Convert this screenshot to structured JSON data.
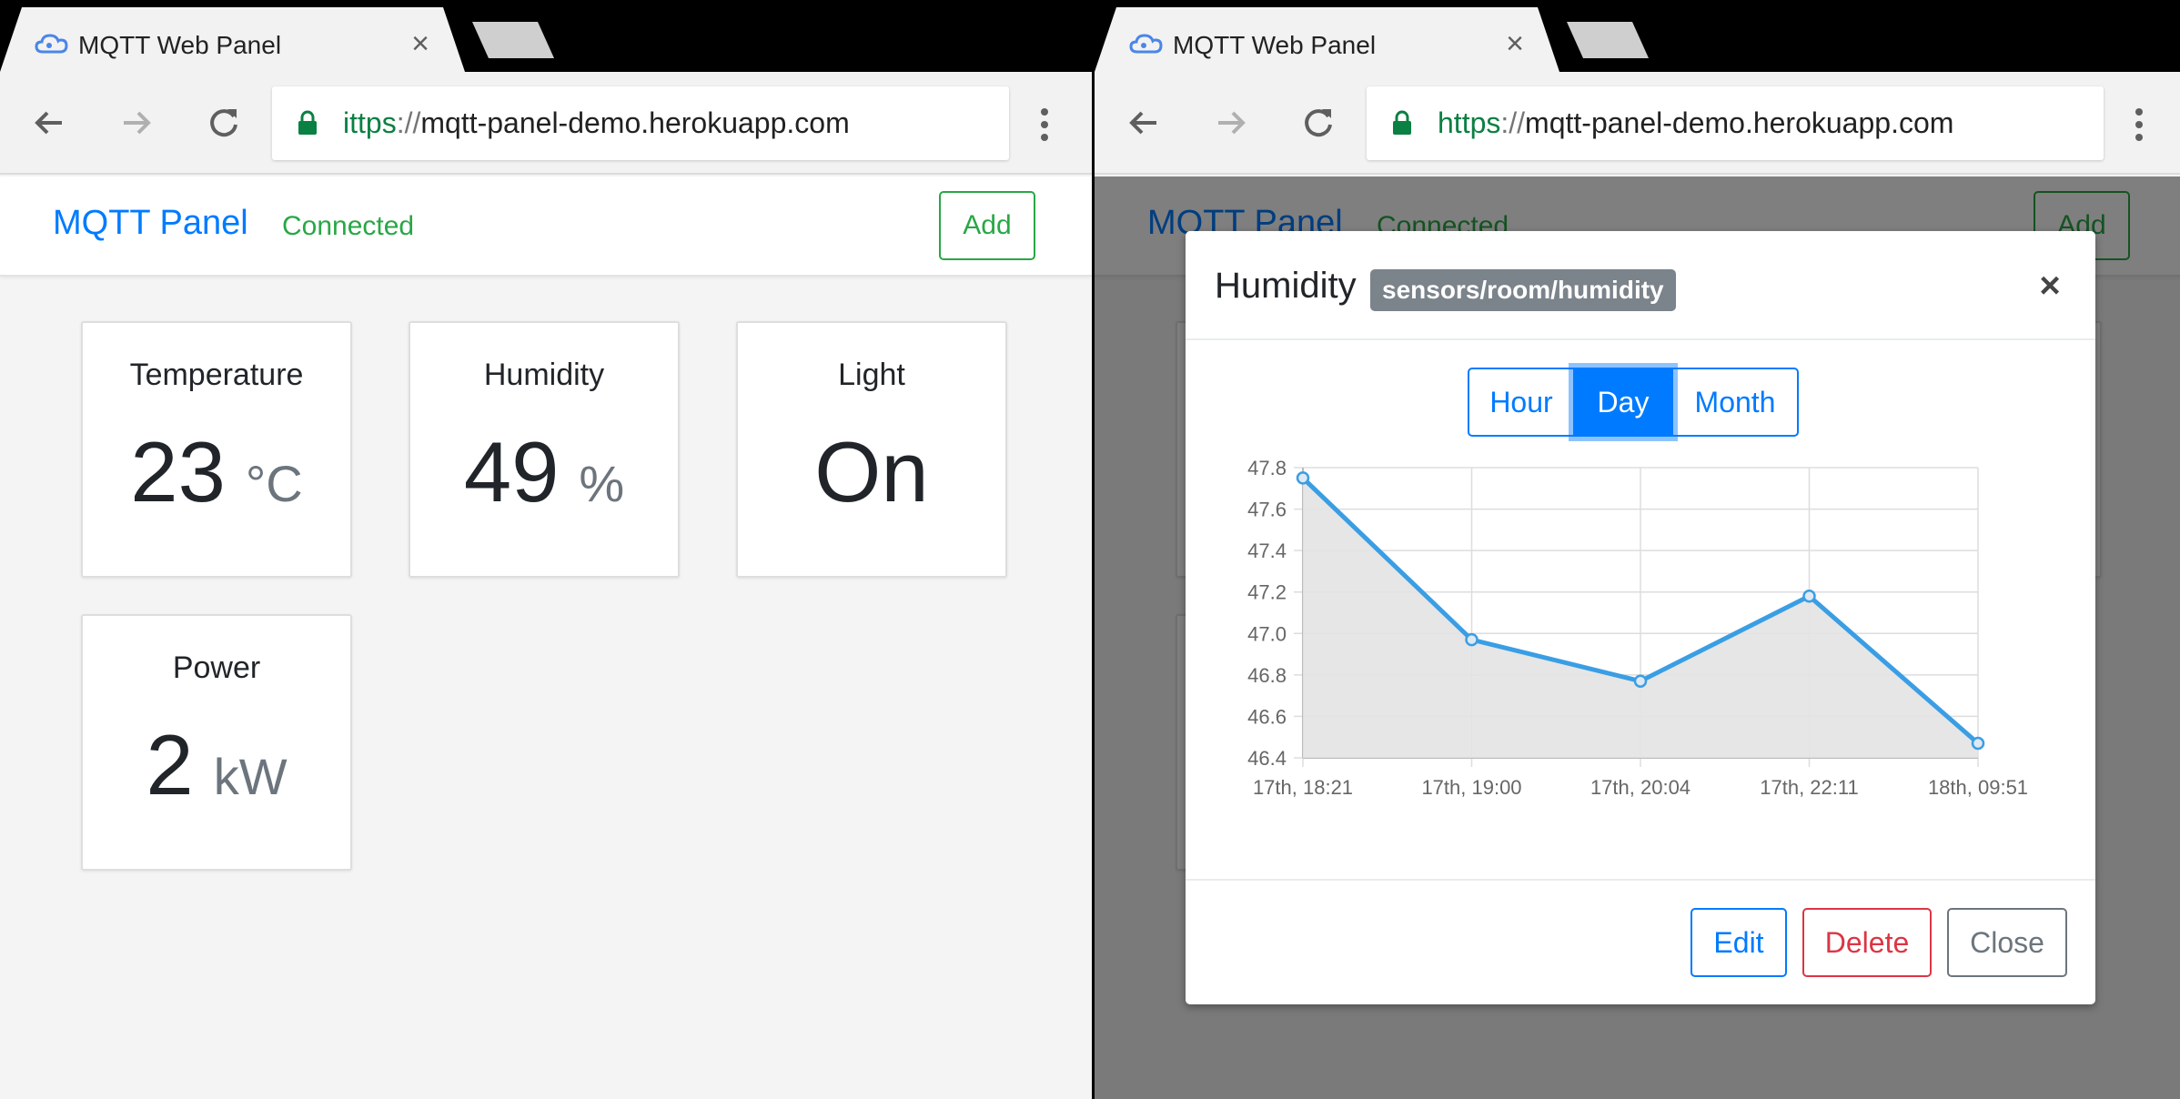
{
  "browser": {
    "tab_title": "MQTT Web Panel",
    "url_scheme": "https",
    "url_separator": "://",
    "url_host": "mqtt-panel-demo.herokuapp.com",
    "left_url_scheme_visible": "ittps"
  },
  "navbar": {
    "brand": "MQTT Panel",
    "status": "Connected",
    "add_label": "Add"
  },
  "cards": [
    {
      "title": "Temperature",
      "value": "23",
      "unit": "°C"
    },
    {
      "title": "Humidity",
      "value": "49",
      "unit": "%"
    },
    {
      "title": "Light",
      "value": "On",
      "unit": ""
    },
    {
      "title": "Power",
      "value": "2",
      "unit": "kW"
    }
  ],
  "modal": {
    "title": "Humidity",
    "topic": "sensors/room/humidity",
    "close_symbol": "×",
    "ranges": [
      "Hour",
      "Day",
      "Month"
    ],
    "active_range": "Day",
    "buttons": {
      "edit": "Edit",
      "delete": "Delete",
      "close": "Close"
    }
  },
  "chart_data": {
    "type": "area",
    "x": [
      "17th, 18:21",
      "17th, 19:00",
      "17th, 20:04",
      "17th, 22:11",
      "18th, 09:51"
    ],
    "series": [
      {
        "values": [
          47.75,
          46.97,
          46.77,
          47.18,
          46.47
        ]
      }
    ],
    "ylim": [
      46.4,
      47.8
    ],
    "yticks": [
      "47.8",
      "47.6",
      "47.4",
      "47.2",
      "47.0",
      "46.8",
      "46.6",
      "46.4"
    ],
    "grid": true,
    "colors": {
      "line": "#3a9ee4",
      "fill": "#e3e3e3",
      "grid": "#dddddd"
    }
  },
  "colors": {
    "primary": "#007bff",
    "success": "#28a745",
    "danger": "#dc3545",
    "secondary": "#6c757d"
  }
}
